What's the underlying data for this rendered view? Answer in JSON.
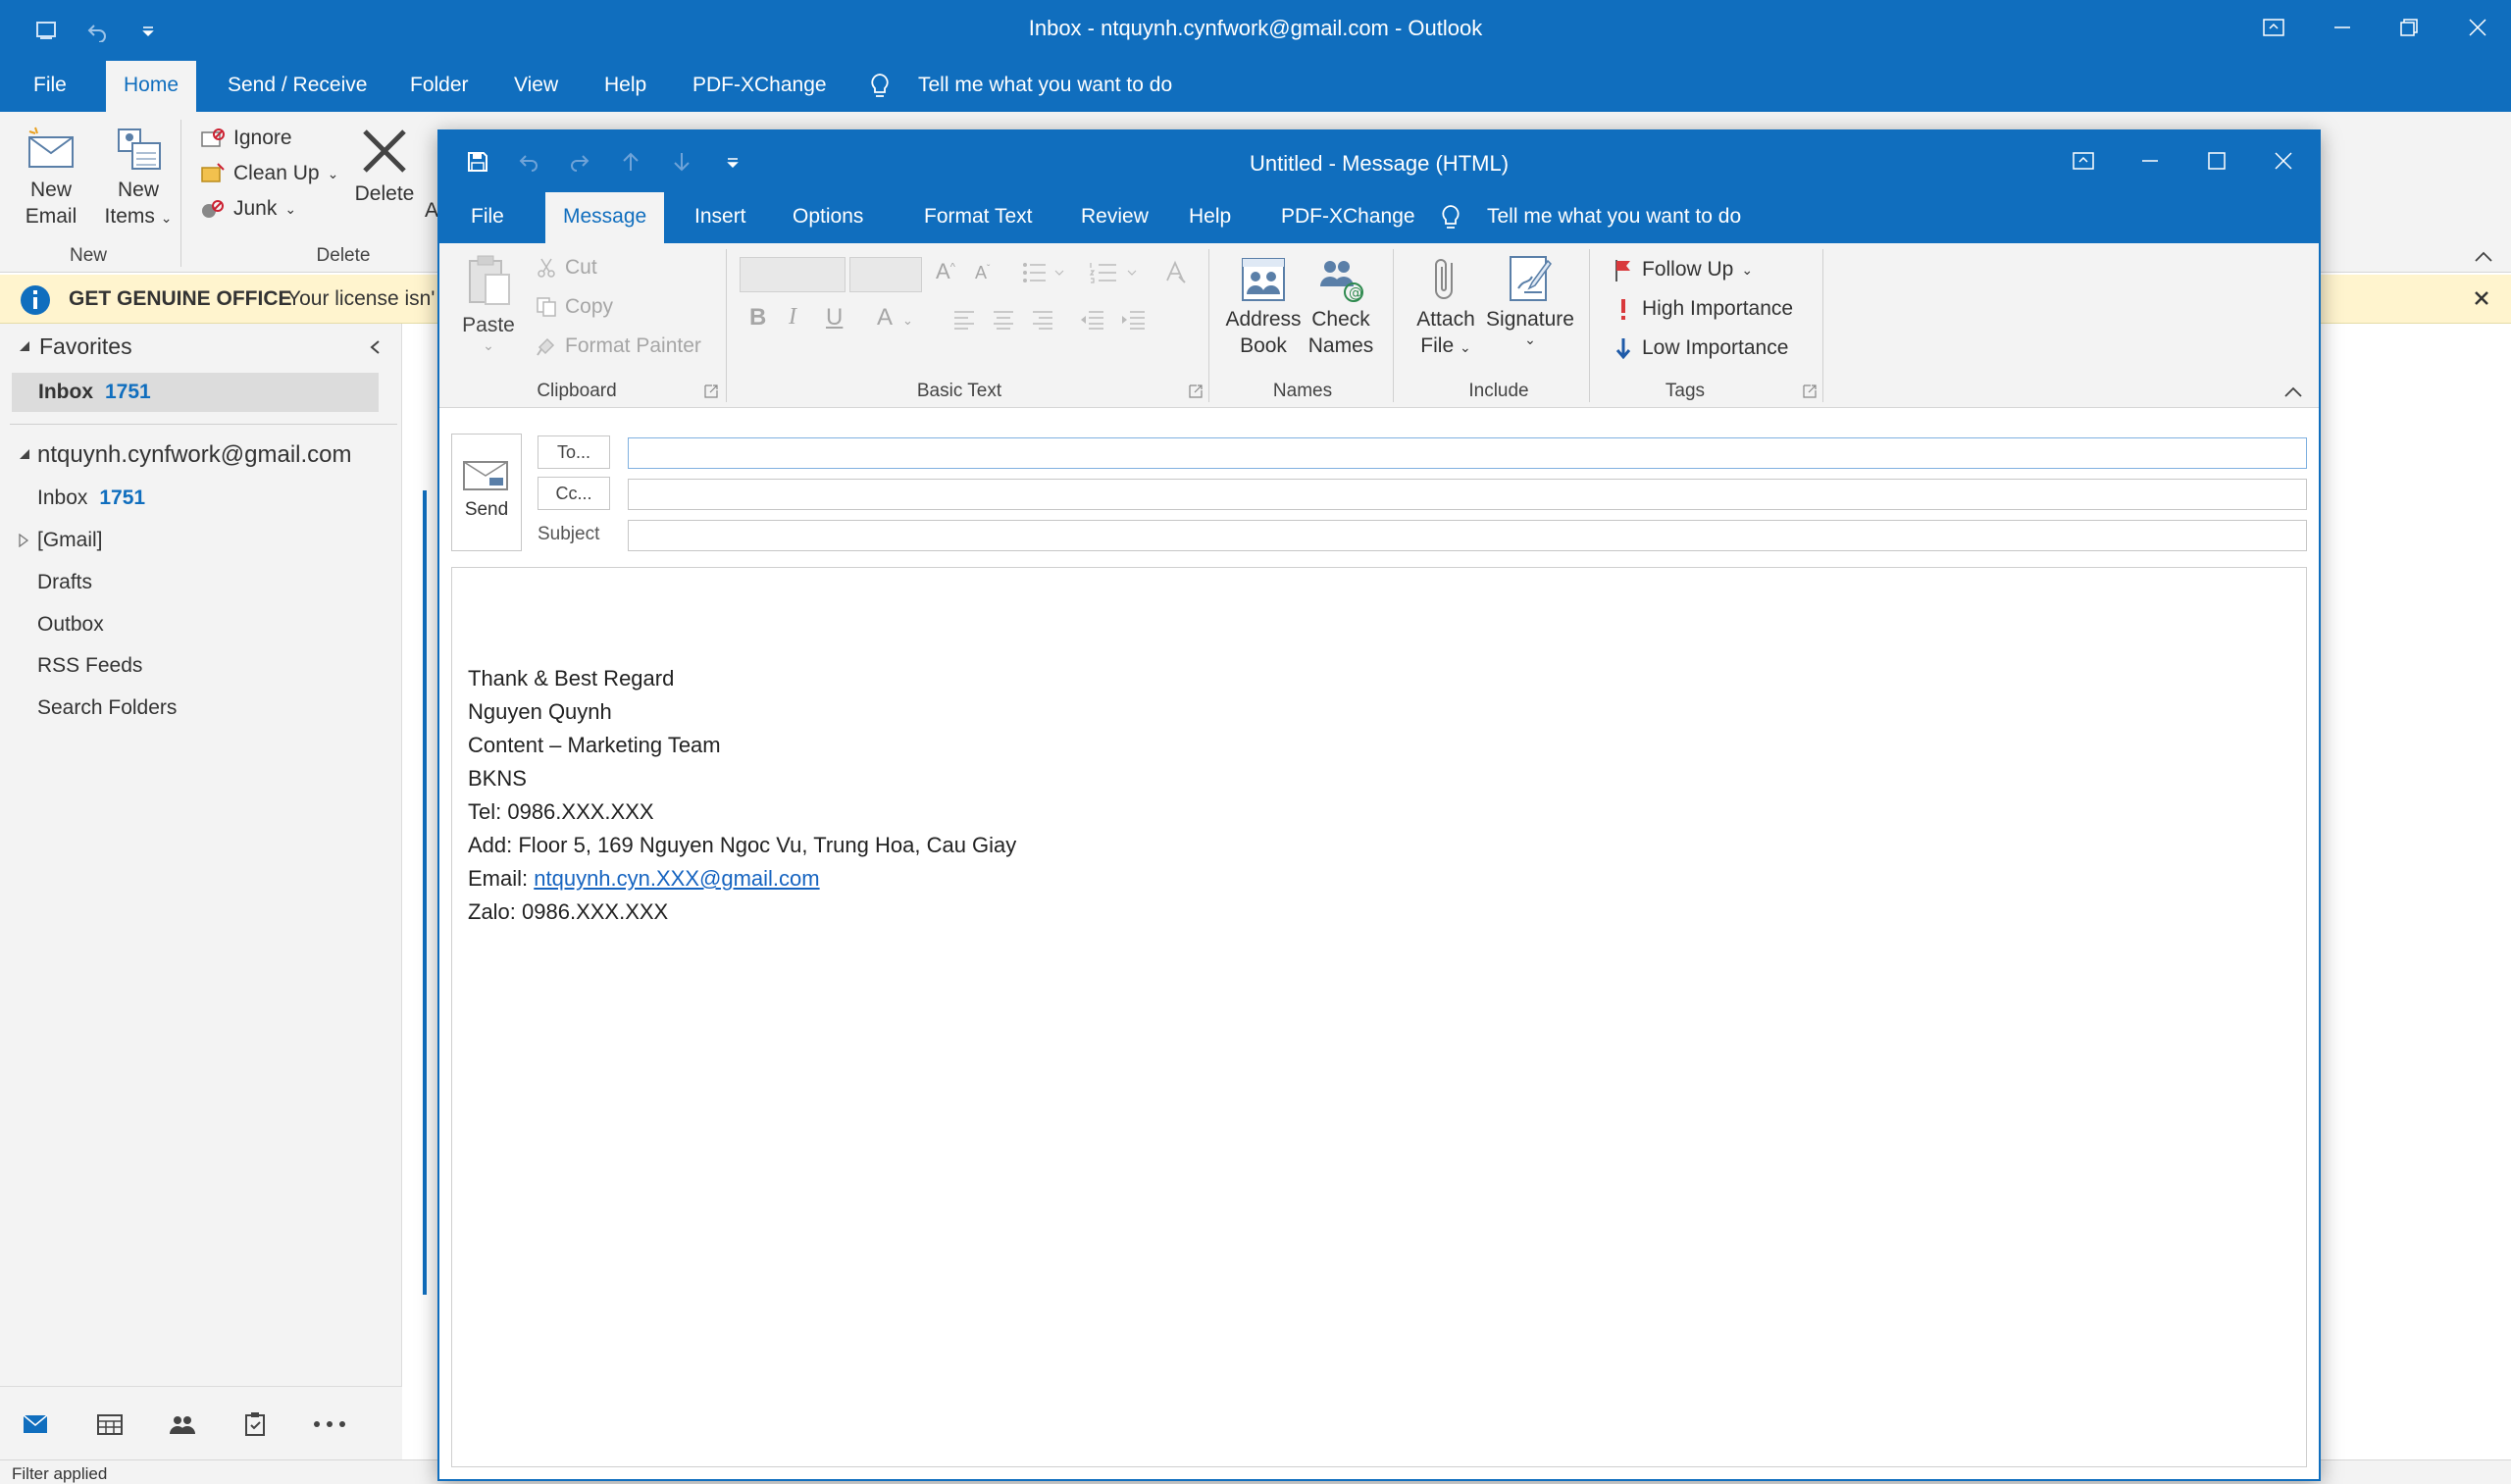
{
  "main_window": {
    "title": "Inbox - ntquynh.cynfwork@gmail.com  -  Outlook",
    "tabs": [
      "File",
      "Home",
      "Send / Receive",
      "Folder",
      "View",
      "Help",
      "PDF-XChange"
    ],
    "tell_me": "Tell me what you want to do",
    "ribbon": {
      "new_email": [
        "New",
        "Email"
      ],
      "new_items": [
        "New",
        "Items"
      ],
      "group_new": "New",
      "ignore": "Ignore",
      "clean_up": "Clean Up",
      "junk": "Junk",
      "delete": "Delete",
      "archive_partial": "A",
      "group_delete": "Delete"
    },
    "banner": {
      "title": "GET GENUINE OFFICE",
      "text": "Your license isn'"
    },
    "folders": {
      "favorites": "Favorites",
      "fav_inbox": "Inbox",
      "fav_inbox_count": "1751",
      "account": "ntquynh.cynfwork@gmail.com",
      "inbox": "Inbox",
      "inbox_count": "1751",
      "gmail": "[Gmail]",
      "drafts": "Drafts",
      "outbox": "Outbox",
      "rss": "RSS Feeds",
      "search_folders": "Search Folders"
    },
    "status": "Filter applied"
  },
  "compose": {
    "title": "Untitled  -  Message (HTML)",
    "tabs": [
      "File",
      "Message",
      "Insert",
      "Options",
      "Format Text",
      "Review",
      "Help",
      "PDF-XChange"
    ],
    "tell_me": "Tell me what you want to do",
    "ribbon": {
      "paste": "Paste",
      "cut": "Cut",
      "copy": "Copy",
      "format_painter": "Format Painter",
      "group_clipboard": "Clipboard",
      "group_basic_text": "Basic Text",
      "address_book": [
        "Address",
        "Book"
      ],
      "check_names": [
        "Check",
        "Names"
      ],
      "group_names": "Names",
      "attach_file": [
        "Attach",
        "File"
      ],
      "signature": "Signature",
      "group_include": "Include",
      "follow_up": "Follow Up",
      "high_importance": "High Importance",
      "low_importance": "Low Importance",
      "group_tags": "Tags"
    },
    "fields": {
      "send": "Send",
      "to": "To...",
      "cc": "Cc...",
      "subject": "Subject",
      "to_value": "",
      "cc_value": "",
      "subject_value": ""
    },
    "signature_lines": [
      "Thank & Best Regard",
      "Nguyen Quynh",
      "Content – Marketing Team",
      "BKNS",
      "Tel: 0986.XXX.XXX",
      "Add: Floor 5, 169 Nguyen Ngoc Vu, Trung Hoa, Cau Giay"
    ],
    "email_label": "Email: ",
    "email_link": "ntquynh.cyn.XXX@gmail.com",
    "zalo": "Zalo: 0986.XXX.XXX"
  },
  "colors": {
    "accent": "#106ebe",
    "banner_bg": "#fff4ce",
    "link": "#1664c0"
  }
}
